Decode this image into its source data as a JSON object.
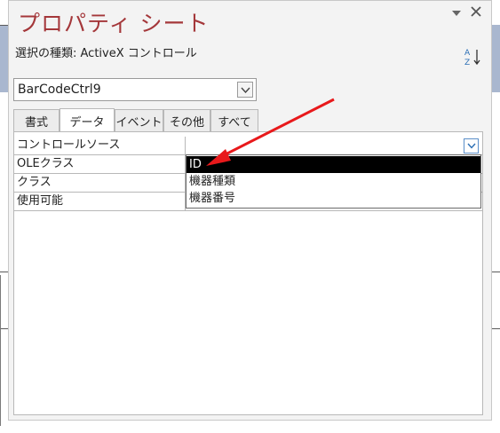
{
  "panel": {
    "title": "プロパティ シート",
    "selection_type": "選択の種類:  ActiveX コントロール",
    "object_selector": {
      "value": "BarCodeCtrl9"
    },
    "tabs": [
      {
        "label": "書式",
        "active": false
      },
      {
        "label": "データ",
        "active": true
      },
      {
        "label": "イベント",
        "active": false
      },
      {
        "label": "その他",
        "active": false
      },
      {
        "label": "すべて",
        "active": false
      }
    ],
    "properties": [
      {
        "name": "コントロールソース",
        "value": ""
      },
      {
        "name": "OLEクラス",
        "value": ""
      },
      {
        "name": "クラス",
        "value": ""
      },
      {
        "name": "使用可能",
        "value": ""
      }
    ],
    "dropdown_options": [
      {
        "label": "ID",
        "selected": true
      },
      {
        "label": "機器種類",
        "selected": false
      },
      {
        "label": "機器番号",
        "selected": false
      }
    ]
  },
  "icons": {
    "sort": "sort-az-icon",
    "pin": "chevron-down-icon",
    "close": "close-icon",
    "dropdown": "chevron-down-icon"
  },
  "colors": {
    "title": "#a4373a",
    "arrow": "#e8191b",
    "selected_bg": "#000000",
    "dropdown_border": "#5b8fc9"
  }
}
